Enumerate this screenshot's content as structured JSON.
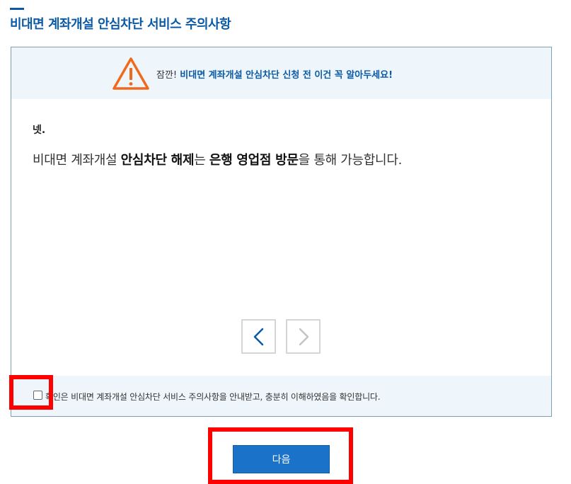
{
  "header": {
    "title": "비대면 계좌개설 안심차단 서비스 주의사항"
  },
  "notice": {
    "icon": "warning-triangle-icon",
    "icon_color": "#f06a1d",
    "prefix": "잠깐!",
    "message": "비대면 계좌개설 안심차단 신청 전 이건 꼭 알아두세요!"
  },
  "content": {
    "label": "넷.",
    "text_part1": "비대면 계좌개설 ",
    "text_bold1": "안심차단 해제",
    "text_part2": "는 ",
    "text_bold2": "은행 영업점 방문",
    "text_part3": "을 통해 가능합니다."
  },
  "pager": {
    "prev_icon": "chevron-left-icon",
    "next_icon": "chevron-right-icon"
  },
  "confirm": {
    "checked": false,
    "label": "확인은 비대면 계좌개설 안심차단 서비스 주의사항을 안내받고, 충분히 이해하였음을 확인합니다."
  },
  "actions": {
    "next_label": "다음"
  },
  "colors": {
    "accent": "#0b5aa6",
    "button": "#1a73c8",
    "highlight": "#ff0000"
  }
}
